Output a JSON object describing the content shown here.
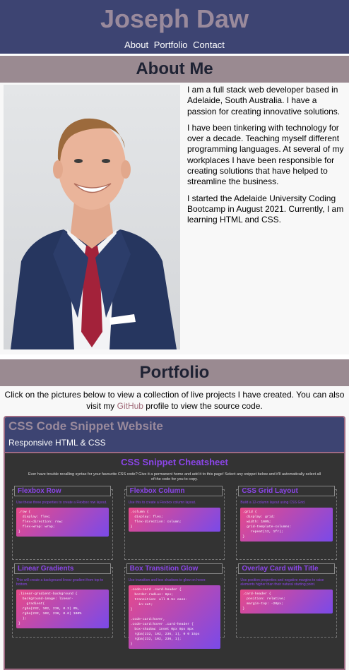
{
  "header": {
    "title": "Joseph Daw",
    "nav": [
      "About",
      "Portfolio",
      "Contact"
    ]
  },
  "about": {
    "heading": "About Me",
    "paragraphs": [
      "I am a full stack web developer based in Adelaide, South Australia. I have a passion for creating innovative solutions.",
      "I have been tinkering with technology for over a decade. Teaching myself different programming languages. At several of my workplaces I have been responsible for creating solutions that have helped to streamline the business.",
      "I started the Adelaide University Coding Bootcamp in August 2021. Currently, I am learning HTML and CSS."
    ]
  },
  "portfolio": {
    "heading": "Portfolio",
    "intro_before": "Click on the pictures below to view a collection of live projects I have created. You can also visit my ",
    "link": "GitHub",
    "intro_after": " profile to view the source code.",
    "project": {
      "title": "CSS Code Snippet Website",
      "subtitle": "Responsive HTML & CSS",
      "shot": {
        "title": "CSS Snippet Cheatsheet",
        "intro": "Ever have trouble recalling syntax for your favourite CSS code? Give it a permanent home and add it to this page! Select any snippet below and it'll automatically select all of the code for you to copy.",
        "cells": [
          {
            "h": "Flexbox Row",
            "d": "Use these three properties to create a Flexbox row layout.",
            "code": ".row {\n  display: flex;\n  flex-direction: row;\n  flex-wrap: wrap;\n}"
          },
          {
            "h": "Flexbox Column",
            "d": "Use this to create a Flexbox column layout.",
            "code": ".column {\n  display: flex;\n  flex-direction: column;\n}"
          },
          {
            "h": "CSS Grid Layout",
            "d": "Build a 12-column layout using CSS Grid.",
            "code": ".grid {\n  display: grid;\n  width: 100%;\n  grid-template-columns:\n    repeat(12, 1fr);\n}"
          },
          {
            "h": "Linear Gradients",
            "d": "This will create a background linear gradient from top to bottom.",
            "code": ".linear-gradient-background {\n  background-image: linear-\n    gradient(\n  rgba(232, 102, 236, 0.3) 0%,\n  rgba(232, 102, 236, 0.6) 100%\n  );\n}"
          },
          {
            "h": "Box Transition Glow",
            "d": "Use transition and box shadows to glow on hover.",
            "code": ".code-card .card-header {\n  border-radius: 8px;\n  transition: all 0.5s ease-\n    in-out;\n}\n\n.code-card:hover,\n.code-card:hover .card-header {\n  box-shadow: inset 0px 0px 8px\n  rgba(232, 102, 236, 1), 0 0 15px\n  rgba(232, 102, 236, 1);\n}"
          },
          {
            "h": "Overlay Card with Title",
            "d": "Use position properties and negative margins to raise elements higher than their natural starting point.",
            "code": ".card-header {\n  position: relative;\n  margin-top: -20px;\n}"
          }
        ]
      }
    }
  }
}
